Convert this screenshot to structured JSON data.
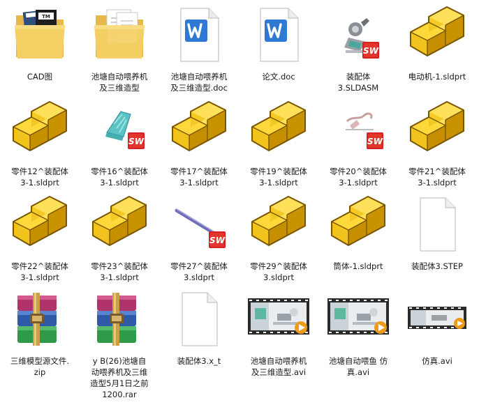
{
  "files": [
    {
      "label": "CAD图",
      "icon": "folder-with-documents-icon",
      "kind": "folder-cad"
    },
    {
      "label": "池塘自动喂养机\n及三维造型",
      "icon": "folder-with-documents-icon",
      "kind": "folder-docs"
    },
    {
      "label": "池塘自动喂养机\n及三维造型.doc",
      "icon": "word-document-icon",
      "kind": "word"
    },
    {
      "label": "论文.doc",
      "icon": "word-document-icon",
      "kind": "word"
    },
    {
      "label": "装配体\n3.SLDASM",
      "icon": "solidworks-assembly-icon",
      "kind": "asm"
    },
    {
      "label": "电动机-1.sldprt",
      "icon": "solidworks-part-icon",
      "kind": "part"
    },
    {
      "label": "零件12^装配体\n3-1.sldprt",
      "icon": "solidworks-part-icon",
      "kind": "part"
    },
    {
      "label": "零件16^装配体\n3-1.sldprt",
      "icon": "solidworks-part-preview-icon",
      "kind": "part-teal"
    },
    {
      "label": "零件17^装配体\n3-1.sldprt",
      "icon": "solidworks-part-icon",
      "kind": "part"
    },
    {
      "label": "零件19^装配体\n3-1.sldprt",
      "icon": "solidworks-part-icon",
      "kind": "part"
    },
    {
      "label": "零件20^装配体\n3-1.sldprt",
      "icon": "solidworks-part-preview-icon",
      "kind": "part-red"
    },
    {
      "label": "零件21^装配体\n3-1.sldprt",
      "icon": "solidworks-part-icon",
      "kind": "part"
    },
    {
      "label": "零件22^装配体\n3-1.sldprt",
      "icon": "solidworks-part-icon",
      "kind": "part"
    },
    {
      "label": "零件23^装配体\n3-1.sldprt",
      "icon": "solidworks-part-icon",
      "kind": "part"
    },
    {
      "label": "零件27^装配体\n3.sldprt",
      "icon": "solidworks-part-preview-icon",
      "kind": "part-rod"
    },
    {
      "label": "零件29^装配体\n3.sldprt",
      "icon": "solidworks-part-icon",
      "kind": "part"
    },
    {
      "label": "筒体-1.sldprt",
      "icon": "solidworks-part-icon",
      "kind": "part"
    },
    {
      "label": "装配体3.STEP",
      "icon": "blank-file-icon",
      "kind": "blank"
    },
    {
      "label": "三维模型源文件.\nzip",
      "icon": "winrar-archive-icon",
      "kind": "rar"
    },
    {
      "label": "y      B(26)池塘自\n动喂养机及三维\n造型5月1日之前\n1200.rar",
      "icon": "winrar-archive-icon",
      "kind": "rar"
    },
    {
      "label": "装配体3.x_t",
      "icon": "blank-file-icon",
      "kind": "blank"
    },
    {
      "label": "池塘自动喂养机\n及三维造型.avi",
      "icon": "video-thumbnail-icon",
      "kind": "video"
    },
    {
      "label": "池塘自动喂鱼 仿\n真.avi",
      "icon": "video-thumbnail-icon",
      "kind": "video"
    },
    {
      "label": "仿真.avi",
      "icon": "video-thumbnail-icon",
      "kind": "video-small"
    }
  ]
}
